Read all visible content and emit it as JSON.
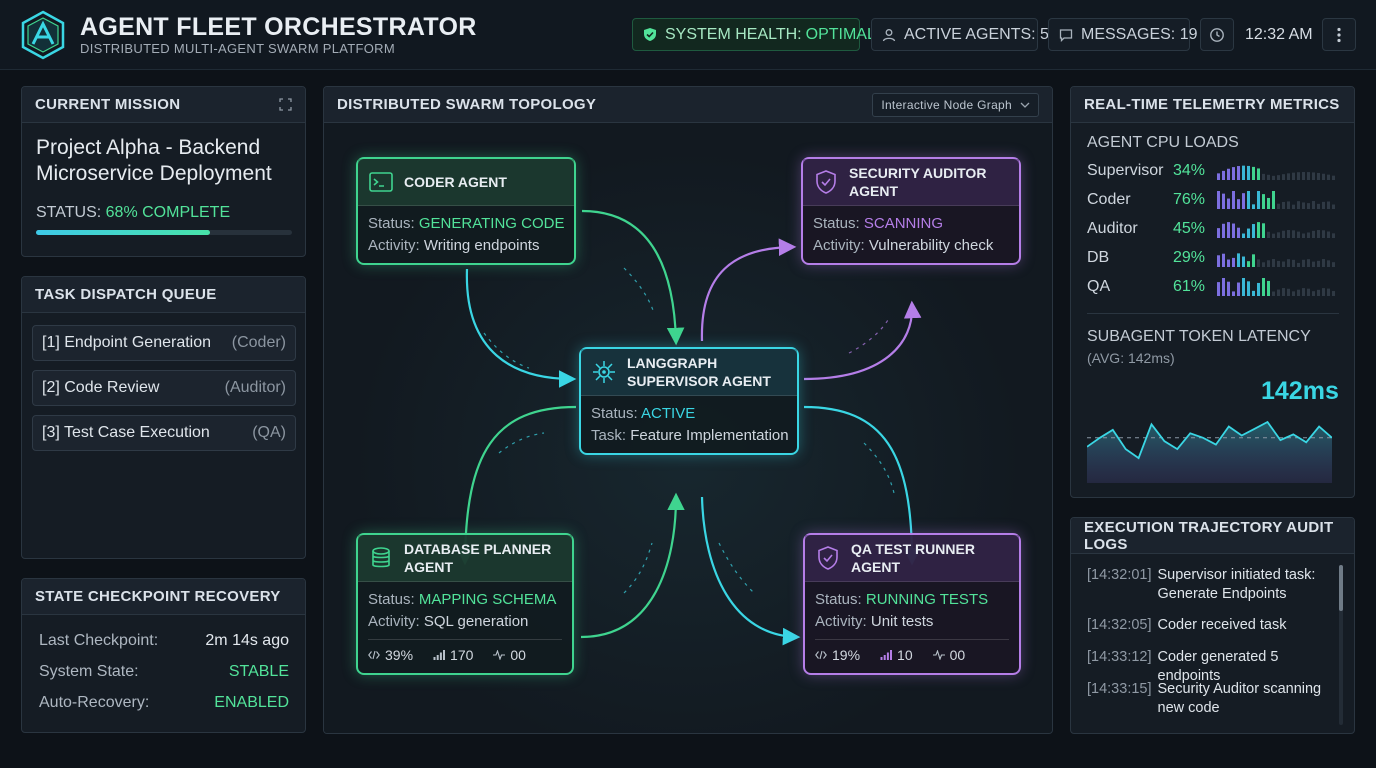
{
  "header": {
    "title": "AGENT FLEET ORCHESTRATOR",
    "subtitle": "DISTRIBUTED MULTI-AGENT SWARM PLATFORM",
    "health_label": "SYSTEM HEALTH:",
    "health_value": "OPTIMAL",
    "agents_label": "ACTIVE AGENTS: 5",
    "messages_label": "MESSAGES: 19",
    "time": "12:32 AM"
  },
  "mission": {
    "heading": "CURRENT MISSION",
    "title": "Project Alpha - Backend Microservice Deployment",
    "status_label": "STATUS:",
    "status_value": "68% COMPLETE",
    "progress": 0.68
  },
  "queue": {
    "heading": "TASK DISPATCH QUEUE",
    "items": [
      {
        "name": "[1]  Endpoint Generation",
        "agent": "(Coder)"
      },
      {
        "name": "[2]  Code Review",
        "agent": "(Auditor)"
      },
      {
        "name": "[3]  Test Case Execution",
        "agent": "(QA)"
      }
    ]
  },
  "checkpoint": {
    "heading": "STATE CHECKPOINT RECOVERY",
    "rows": [
      {
        "key": "Last Checkpoint:",
        "value": "2m 14s ago"
      },
      {
        "key": "System State:",
        "value": "STABLE"
      },
      {
        "key": "Auto-Recovery:",
        "value": "ENABLED"
      }
    ]
  },
  "topology": {
    "heading": "DISTRIBUTED SWARM TOPOLOGY",
    "view_select": "Interactive Node Graph",
    "agents": {
      "coder": {
        "name": "CODER AGENT",
        "status": "GENERATING CODE",
        "activity": "Writing endpoints"
      },
      "security": {
        "name_1": "SECURITY AUDITOR",
        "name_2": "AGENT",
        "status": "SCANNING",
        "activity": "Vulnerability check"
      },
      "supervisor": {
        "name_1": "LANGGRAPH",
        "name_2": "SUPERVISOR AGENT",
        "status": "ACTIVE",
        "task": "Feature Implementation"
      },
      "db": {
        "name_1": "DATABASE PLANNER",
        "name_2": "AGENT",
        "status": "MAPPING SCHEMA",
        "activity": "SQL generation",
        "stat_1": "39%",
        "stat_2": "170",
        "stat_3": "00"
      },
      "qa": {
        "name_1": "QA TEST RUNNER",
        "name_2": "AGENT",
        "status": "RUNNING TESTS",
        "activity": "Unit tests",
        "stat_1": "19%",
        "stat_2": "10",
        "stat_3": "00"
      }
    },
    "labels": {
      "status": "Status:",
      "activity": "Activity:",
      "task": "Task:"
    }
  },
  "telemetry": {
    "heading": "REAL-TIME TELEMETRY METRICS",
    "cpu_heading": "AGENT CPU LOADS",
    "cpu": [
      {
        "name": "Supervisor",
        "value": "34%",
        "level": 0.34
      },
      {
        "name": "Coder",
        "value": "76%",
        "level": 0.76
      },
      {
        "name": "Auditor",
        "value": "45%",
        "level": 0.45
      },
      {
        "name": "DB",
        "value": "29%",
        "level": 0.29
      },
      {
        "name": "QA",
        "value": "61%",
        "level": 0.61
      }
    ],
    "latency_heading": "SUBAGENT TOKEN LATENCY",
    "latency_avg": "(AVG: 142ms)",
    "latency_big": "142ms",
    "latency_series": [
      120,
      128,
      135,
      118,
      110,
      140,
      125,
      118,
      132,
      128,
      122,
      138,
      130,
      136,
      142,
      126,
      131,
      124,
      138,
      128
    ]
  },
  "logs": {
    "heading": "EXECUTION TRAJECTORY AUDIT LOGS",
    "entries": [
      {
        "ts": "[14:32:01]",
        "msg": "Supervisor initiated task: Generate Endpoints"
      },
      {
        "ts": "[14:32:05]",
        "msg": "Coder received task"
      },
      {
        "ts": "[14:33:12]",
        "msg": "Coder generated 5 endpoints"
      },
      {
        "ts": "[14:33:15]",
        "msg": "Security Auditor scanning new code"
      }
    ]
  },
  "colors": {
    "green": "#3fd48f",
    "cyan": "#3ad6e4",
    "purple": "#b57ee8",
    "background": "#0d1218"
  }
}
